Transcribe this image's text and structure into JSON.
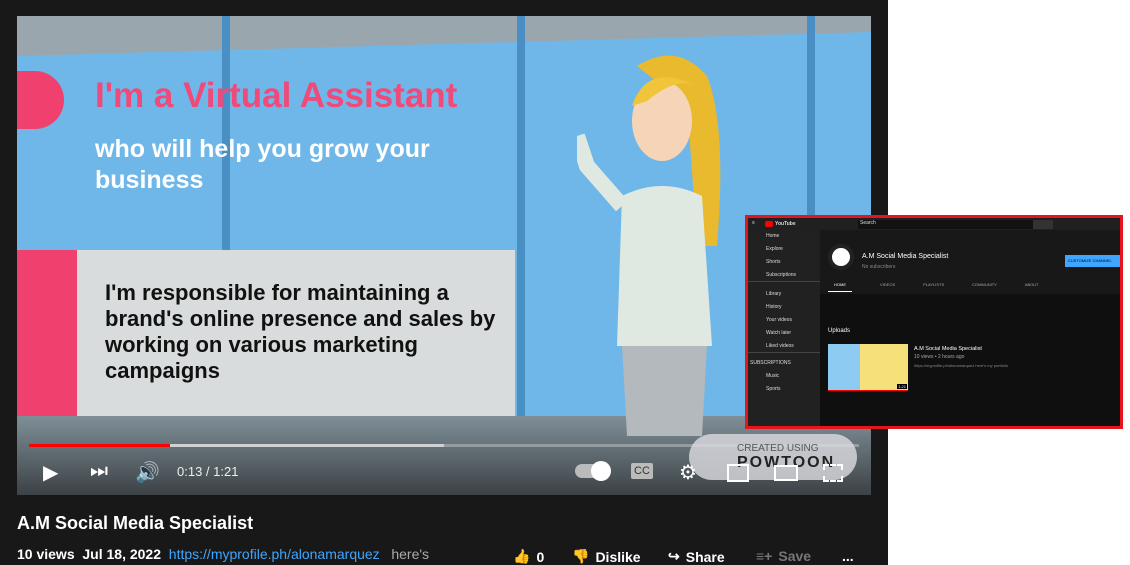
{
  "video": {
    "headline": "I'm a Virtual Assistant",
    "subline": "who will help you grow your business",
    "card_text": "I'm responsible for maintaining a brand's online presence and sales by working on various marketing campaigns",
    "time": "0:13 / 1:21",
    "progress_played": 0.17,
    "progress_buffered": 0.5,
    "watermark_top": "CREATED USING",
    "watermark_brand": "POWTOON"
  },
  "title": "A.M Social Media Specialist",
  "meta": {
    "views": "10 views",
    "date": "Jul 18, 2022",
    "link": "https://myprofile.ph/alonamarquez",
    "desc": "here's"
  },
  "actions": {
    "likes": "0",
    "dislike": "Dislike",
    "share": "Share",
    "save": "Save",
    "more": "..."
  },
  "inset": {
    "logo": "YouTube",
    "search_placeholder": "Search",
    "sidebar": [
      "Home",
      "Explore",
      "Shorts",
      "Subscriptions",
      "Library",
      "History",
      "Your videos",
      "Watch later",
      "Liked videos"
    ],
    "subs_heading": "SUBSCRIPTIONS",
    "subs": [
      "Music",
      "Sports"
    ],
    "channel_name": "A.M Social Media Specialist",
    "channel_sub": "No subscribers",
    "customize": "CUSTOMIZE CHANNEL",
    "tabs": [
      "HOME",
      "VIDEOS",
      "PLAYLISTS",
      "COMMUNITY",
      "ABOUT"
    ],
    "uploads": "Uploads",
    "upload_title": "A.M Social Media Specialist",
    "upload_meta": "10 views • 2 hours ago",
    "upload_desc": "https://myprofile.ph/alonamarquez here's my portfolio",
    "duration": "1:21"
  }
}
